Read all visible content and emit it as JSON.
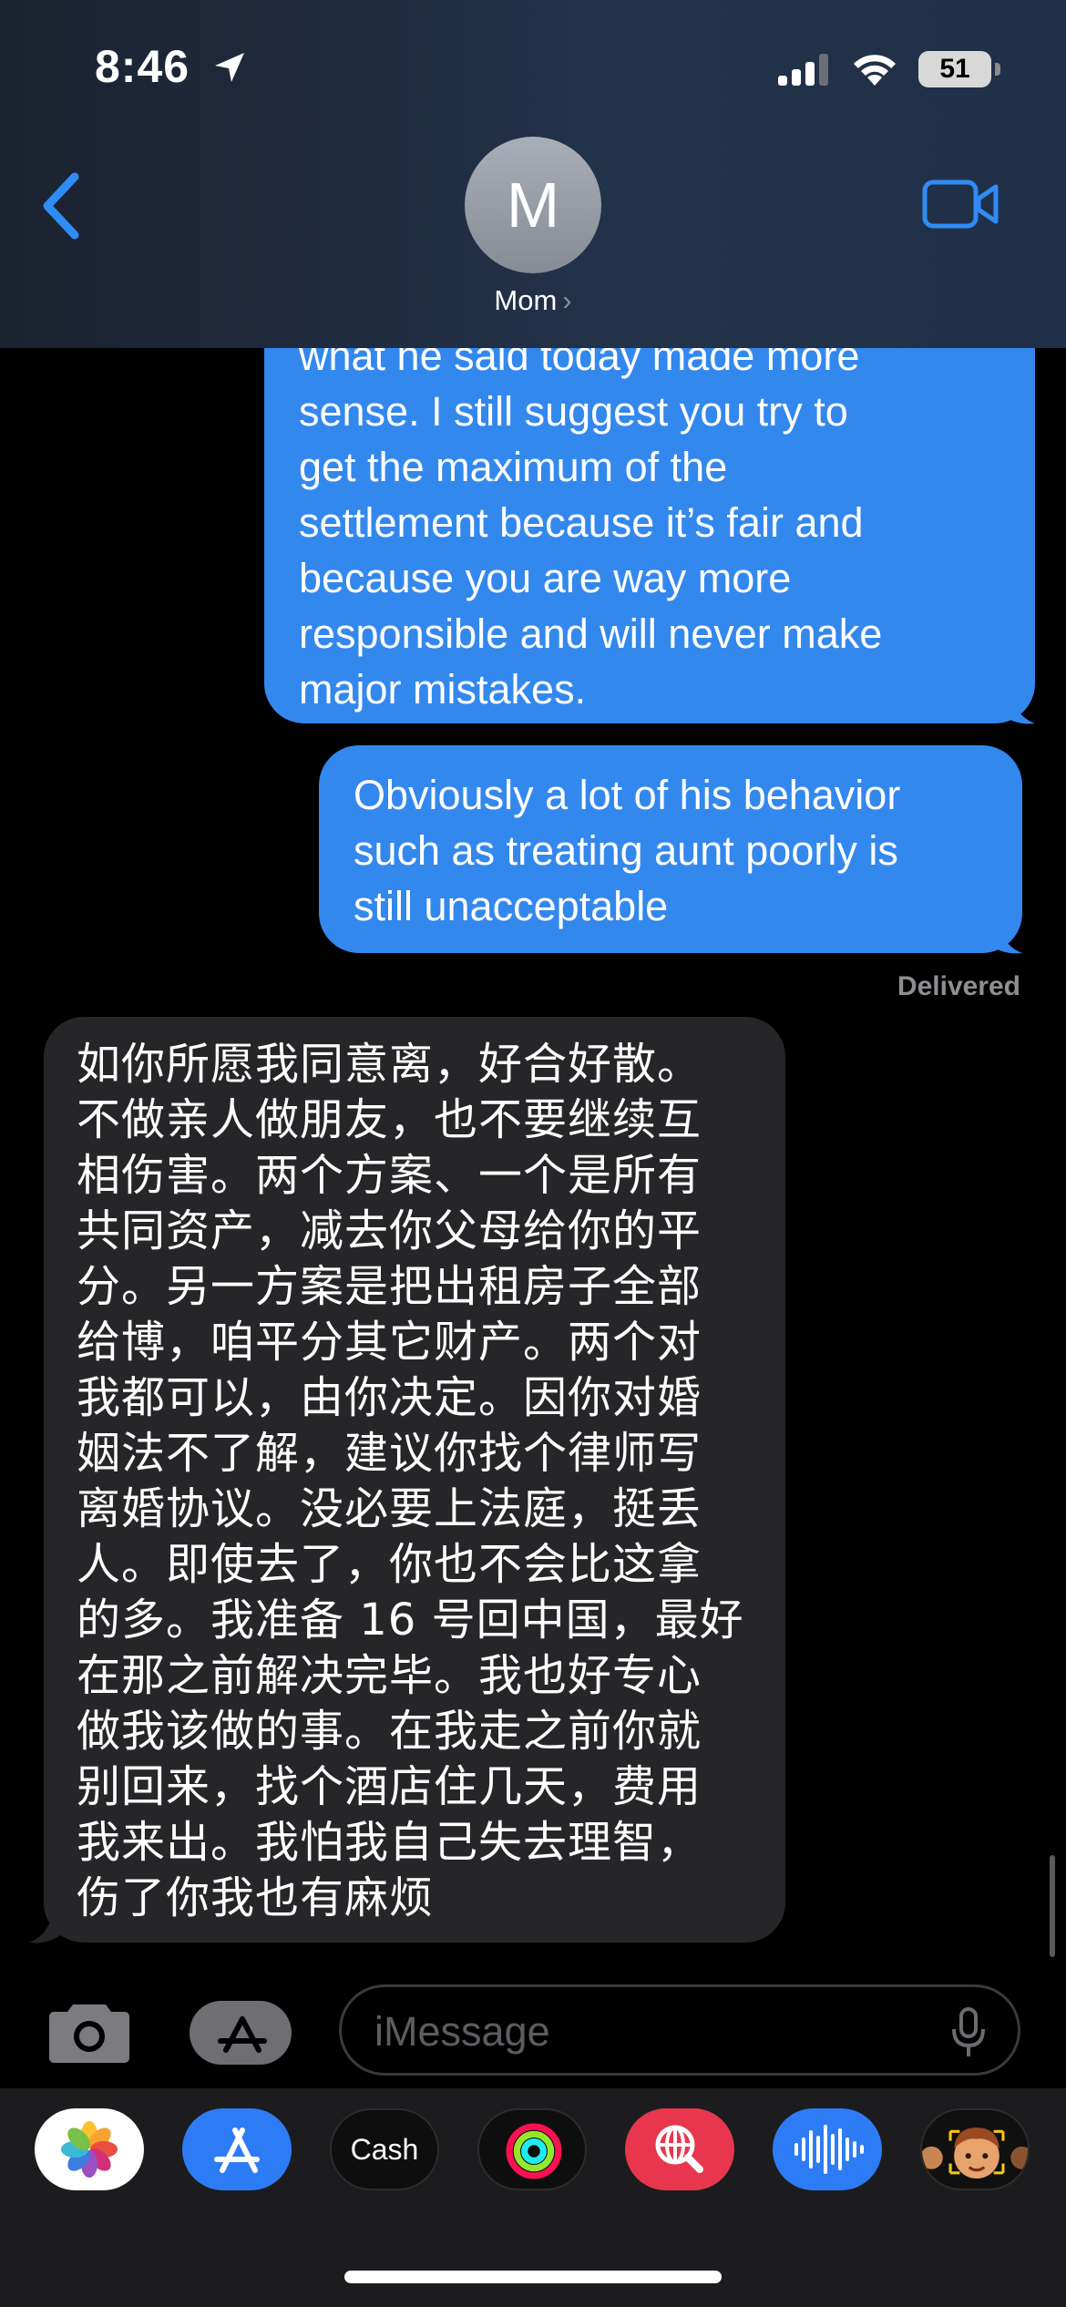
{
  "status_bar": {
    "time": "8:46",
    "battery": "51",
    "location_icon": "location-arrow-icon",
    "signal_icon": "cellular-signal-icon",
    "wifi_icon": "wifi-icon"
  },
  "header": {
    "avatar_initial": "M",
    "contact_name": "Mom",
    "contact_chevron": "›",
    "back_icon": "chevron-left-icon",
    "video_icon": "video-camera-icon"
  },
  "messages": [
    {
      "direction": "sent",
      "text": "what he said today made more\nsense. I still suggest you try to\nget the maximum of the\nsettlement because it’s fair and\nbecause you are way more\nresponsible and will never make\nmajor mistakes."
    },
    {
      "direction": "sent",
      "text": "Obviously a lot of his behavior\nsuch as treating aunt poorly is\nstill unacceptable"
    },
    {
      "direction": "received",
      "text": "如你所愿我同意离，好合好散。\n不做亲人做朋友，也不要继续互\n相伤害。两个方案、一个是所有\n共同资产，减去你父母给你的平\n分。另一方案是把出租房子全部\n给博，咱平分其它财产。两个对\n我都可以，由你决定。因你对婚\n姻法不了解，建议你找个律师写\n离婚协议。没必要上法庭，挺丢\n人。即使去了，你也不会比这拿\n的多。我准备 16 号回中国，最好\n在那之前解决完毕。我也好专心\n做我该做的事。在我走之前你就\n别回来，找个酒店住几天，费用\n我来出。我怕我自己失去理智，\n伤了你我也有麻烦"
    }
  ],
  "delivered_label": "Delivered",
  "input_bar": {
    "placeholder": "iMessage",
    "camera_icon": "camera-icon",
    "apps_icon": "app-store-icon",
    "mic_icon": "microphone-icon"
  },
  "app_drawer": {
    "apps": [
      "Photos",
      "App Store",
      "Cash",
      "Activity",
      "Images",
      "Audio",
      "Memoji"
    ],
    "cash_label": "Cash"
  },
  "colors": {
    "sent_bubble": "#3388ee",
    "received_bubble": "#262629",
    "accent": "#2f8cf5",
    "background": "#000000"
  }
}
